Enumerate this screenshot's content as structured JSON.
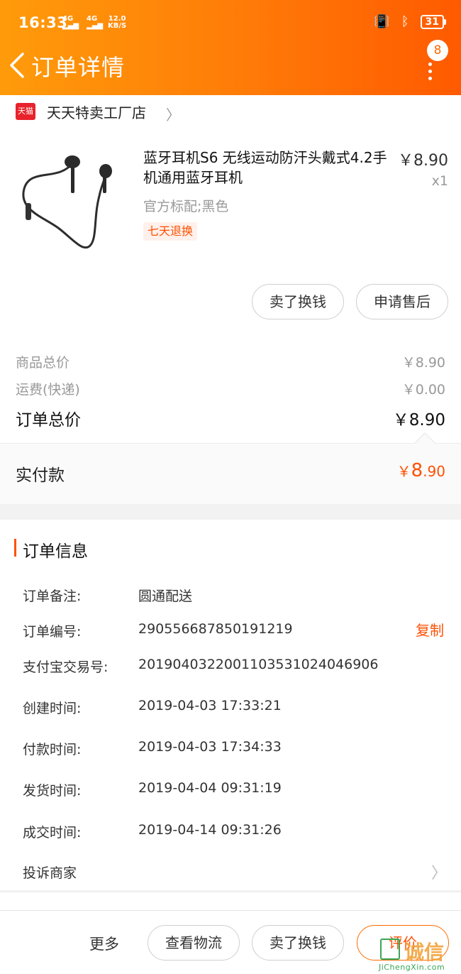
{
  "status_bar": {
    "time": "16:33",
    "net1": "4G",
    "net2": "4G",
    "speed_value": "12.0",
    "speed_unit": "KB/S",
    "battery": "31"
  },
  "nav": {
    "title": "订单详情",
    "badge_count": "8"
  },
  "shop": {
    "logo_text": "天猫",
    "name": "天天特卖工厂店"
  },
  "product": {
    "title": "蓝牙耳机S6 无线运动防汗头戴式4.2手机通用蓝牙耳机",
    "price": "￥8.90",
    "qty": "x1",
    "sku": "官方标配;黑色",
    "tag": "七天退换",
    "actions": [
      "卖了换钱",
      "申请售后"
    ]
  },
  "costs": [
    {
      "label": "商品总价",
      "value": "￥8.90"
    },
    {
      "label": "运费(快递)",
      "value": "￥0.00"
    }
  ],
  "order_total": {
    "label": "订单总价",
    "value": "￥8.90"
  },
  "paid": {
    "label": "实付款",
    "currency": "￥",
    "int": "8",
    "dec": ".90"
  },
  "order_info": {
    "title": "订单信息",
    "rows": [
      {
        "label": "订单备注:",
        "value": "圆通配送"
      },
      {
        "label": "订单编号:",
        "value": "290556687850191219"
      },
      {
        "label": "支付宝交易号:",
        "value": "2019040322001103531024046906"
      },
      {
        "label": "创建时间:",
        "value": "2019-04-03 17:33:21"
      },
      {
        "label": "付款时间:",
        "value": "2019-04-03 17:34:33"
      },
      {
        "label": "发货时间:",
        "value": "2019-04-04 09:31:19"
      },
      {
        "label": "成交时间:",
        "value": "2019-04-14 09:31:26"
      }
    ],
    "copy_label": "复制",
    "complain_label": "投诉商家"
  },
  "bottom": {
    "more": "更多",
    "buttons": [
      "查看物流",
      "卖了换钱",
      "评价"
    ]
  },
  "watermark": {
    "text": "诚信",
    "sub": "JiChengXin.com"
  },
  "colors": {
    "accent": "#ff5000",
    "header_start": "#ff9b0a",
    "header_end": "#ff5a00"
  }
}
